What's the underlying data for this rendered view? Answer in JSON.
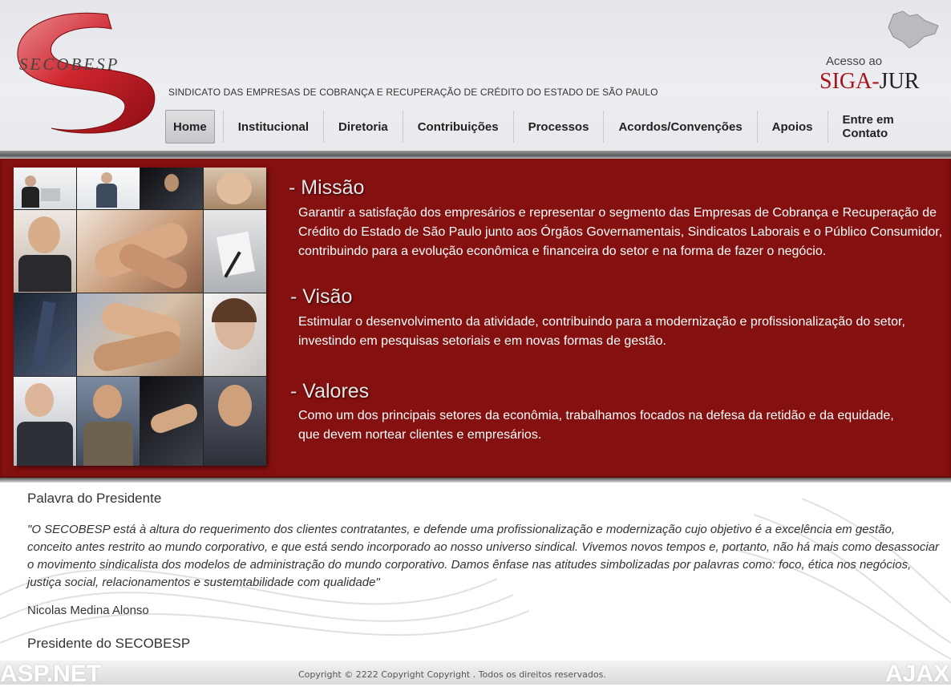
{
  "header": {
    "logo_text": "SECOBESP",
    "subtitle": "SINDICATO DAS EMPRESAS DE COBRANÇA E RECUPERAÇÃO DE CRÉDITO DO ESTADO DE SÃO PAULO",
    "siga_access": "Acesso ao",
    "siga_logo_left": "SIGA-",
    "siga_logo_right": "JUR",
    "icons": [
      "secobesp-logo",
      "sao-paulo-map-icon"
    ]
  },
  "nav": {
    "items": [
      {
        "label": "Home",
        "active": true
      },
      {
        "label": "Institucional"
      },
      {
        "label": "Diretoria"
      },
      {
        "label": "Contribuições"
      },
      {
        "label": "Processos"
      },
      {
        "label": "Acordos/Convenções"
      },
      {
        "label": "Apoios"
      },
      {
        "label": "Entre em Contato"
      }
    ]
  },
  "band": {
    "missao_title": "- Missão",
    "missao_text": "Garantir a satisfação dos empresários e representar o segmento das Empresas de Cobrança e Recuperação de\nCrédito do Estado de São Paulo junto aos Órgãos Governamentais, Sindicatos Laborais e o Público Consumidor,\ncontribuindo para a evolução econômica e financeira do setor e na forma de fazer o negócio.",
    "visao_title": "- Visão",
    "visao_text": "Estimular o desenvolvimento da atividade, contribuindo para a modernização e profissionalização do setor,\ninvestindo em pesquisas setoriais e em novas formas de gestão.",
    "valores_title": "- Valores",
    "valores_text": "Como um dos principais setores da econômia, trabalhamos focados na defesa da retidão e da equidade,\nque devem nortear clientes e empresários."
  },
  "president": {
    "title": "Palavra do Presidente",
    "quote": "\"O SECOBESP está à altura do requerimento dos clientes contratantes, e defende uma profissionalização e modernização cujo objetivo é a excelência em gestão, conceito antes restrito ao mundo corporativo, e que está sendo incorporado ao nosso universo sindical. Vivemos novos tempos e, portanto, não há mais como desassociar o movimento sindicalista dos modelos de administração do mundo corporativo. Damos ênfase nas atitudes simbolizadas por palavras como: foco, ética nos negócios, justiça social, relacionamentos e sustemtabilidade com qualidade\"",
    "name": "Nicolas Medina Alonso",
    "role": "Presidente do SECOBESP"
  },
  "footer": {
    "copyright": "Copyright © 2222  Copyright Copyright . Todos os direitos reservados.",
    "aspnet": "ASP.NET",
    "ajax": "AJAX"
  },
  "colors": {
    "band_red": "#84100f",
    "brand_red": "#a8141c"
  }
}
